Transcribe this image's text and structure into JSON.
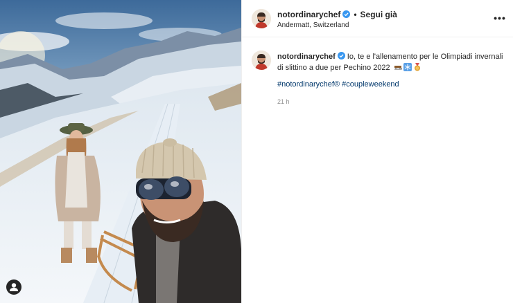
{
  "post": {
    "username": "notordinarychef",
    "follow_label": "Segui già",
    "separator": "•",
    "location": "Andermatt, Switzerland",
    "more_label": "•••",
    "caption": "Io, te e l'allenamento per le Olimpiadi invernali di slittino a due per Pechino 2022",
    "hashtags": "#notordinarychef® #coupleweekend",
    "time_ago": "21 h"
  },
  "colors": {
    "verified": "#3897f0",
    "link": "#00376b",
    "muted": "#8e8e8e"
  },
  "icons": [
    "verified-badge-icon",
    "more-options-icon",
    "user-tag-icon",
    "sled-emoji-icon",
    "snowflake-emoji-icon",
    "medal-emoji-icon"
  ]
}
